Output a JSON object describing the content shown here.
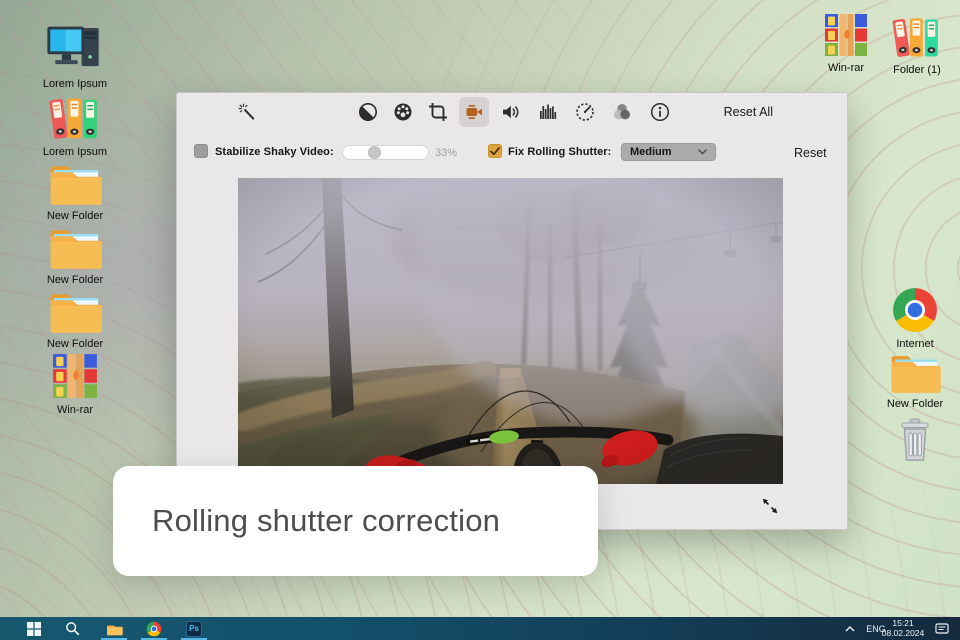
{
  "colors": {
    "accent_orange": "#DFA33C",
    "camera_icon_orange": "#B4621B",
    "glove_red": "#CF1D1D",
    "window_bg": "#E9E7E7",
    "taskbar_left": "#17586F",
    "taskbar_right": "#14293E",
    "underline_blue": "#57B8E8",
    "caption_text": "#4D4D4D"
  },
  "desktop": {
    "left_icons": [
      {
        "label": "Lorem Ipsum",
        "type": "computer"
      },
      {
        "label": "Lorem Ipsum",
        "type": "binders"
      },
      {
        "label": "New Folder",
        "type": "folder"
      },
      {
        "label": "New Folder",
        "type": "folder"
      },
      {
        "label": "New Folder",
        "type": "folder"
      },
      {
        "label": "Win-rar",
        "type": "archive"
      }
    ],
    "top_right_icons": [
      {
        "label": "Win-rar",
        "type": "archive"
      },
      {
        "label": "Folder (1)",
        "type": "binders"
      }
    ],
    "right_icons": [
      {
        "label": "Internet",
        "type": "chrome"
      },
      {
        "label": "New Folder",
        "type": "folder"
      }
    ]
  },
  "window": {
    "toolbar": {
      "reset_all_label": "Reset All",
      "icons": [
        "magic-wand",
        "contrast",
        "color-wheel",
        "crop",
        "video-camera",
        "volume",
        "histogram",
        "speed-gauge",
        "color-circles",
        "info"
      ],
      "active_icon": "video-camera"
    },
    "controls": {
      "stabilize_label": "Stabilize Shaky Video:",
      "stabilize_checked": false,
      "stabilize_value": "33%",
      "rolling_label": "Fix Rolling Shutter:",
      "rolling_checked": true,
      "rolling_value": "Medium",
      "reset_label": "Reset"
    }
  },
  "caption": {
    "text": "Rolling shutter correction"
  },
  "taskbar": {
    "language": "ENG",
    "time": "15:21",
    "date": "08.02.2024"
  }
}
